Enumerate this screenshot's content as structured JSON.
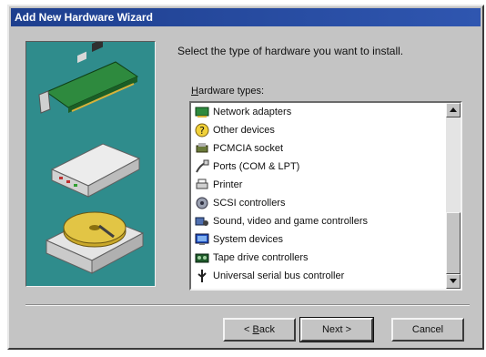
{
  "window": {
    "title": "Add New Hardware Wizard"
  },
  "instruction": "Select the type of hardware you want to install.",
  "list": {
    "label_prefix": "",
    "label_mnemonic": "H",
    "label_rest": "ardware types:",
    "items": [
      {
        "label": "Network adapters",
        "icon": "network-adapter-icon"
      },
      {
        "label": "Other devices",
        "icon": "question-mark-icon"
      },
      {
        "label": "PCMCIA socket",
        "icon": "pcmcia-socket-icon"
      },
      {
        "label": "Ports (COM & LPT)",
        "icon": "port-cable-icon"
      },
      {
        "label": "Printer",
        "icon": "printer-icon"
      },
      {
        "label": "SCSI controllers",
        "icon": "scsi-controller-icon"
      },
      {
        "label": "Sound, video and game controllers",
        "icon": "sound-video-game-icon"
      },
      {
        "label": "System devices",
        "icon": "system-devices-icon"
      },
      {
        "label": "Tape drive controllers",
        "icon": "tape-drive-icon"
      },
      {
        "label": "Universal serial bus controller",
        "icon": "usb-controller-icon"
      }
    ]
  },
  "buttons": {
    "back_mnemonic": "B",
    "back_prefix": "< ",
    "back_rest": "ack",
    "next": "Next >",
    "cancel": "Cancel"
  },
  "colors": {
    "title_bar": "#1e3f8e",
    "dialog_face": "#c4c4c4",
    "art_panel": "#2f8c8c"
  }
}
